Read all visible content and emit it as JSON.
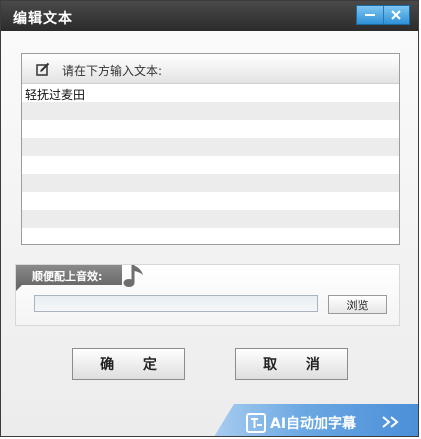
{
  "window": {
    "title": "编辑文本",
    "minimize_icon": "minimize-icon",
    "close_icon": "close-icon"
  },
  "editor": {
    "prompt": "请在下方输入文本:",
    "prompt_icon": "edit-icon",
    "text": "轻抚过麦田"
  },
  "music": {
    "label": "顺便配上音效:",
    "label_icon": "music-note-icon",
    "path_value": "",
    "browse_label": "浏览"
  },
  "buttons": {
    "ok": "确 定",
    "cancel": "取 消"
  },
  "ai_bar": {
    "label": "AI自动加字幕",
    "icon": "subtitle-icon",
    "arrow_icon": "double-chevron-right-icon"
  },
  "colors": {
    "titlebar": "#2c2c2c",
    "window_buttons": "#2f8fd6",
    "ai_bar": "#4b8fd9"
  }
}
